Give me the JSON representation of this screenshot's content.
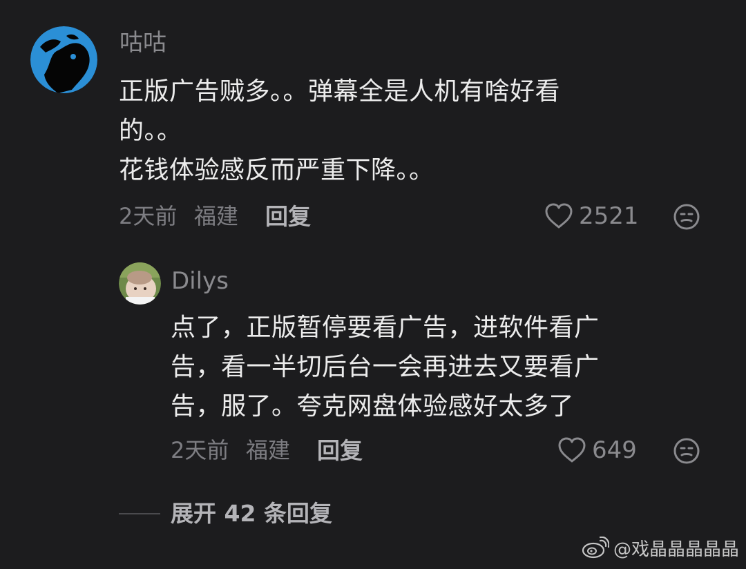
{
  "comments": [
    {
      "username": "咕咕",
      "text": "正版广告贼多。。弹幕全是人机有啥好看\n的。。\n花钱体验感反而严重下降。。",
      "time": "2天前",
      "location": "福建",
      "reply_label": "回复",
      "likes": "2521"
    }
  ],
  "replies": [
    {
      "username": "Dilys",
      "text": "点了，正版暂停要看广告，进软件看广\n告，看一半切后台一会再进去又要看广\n告，服了。夸克网盘体验感好太多了",
      "time": "2天前",
      "location": "福建",
      "reply_label": "回复",
      "likes": "649"
    }
  ],
  "expand_label": "展开 42 条回复",
  "watermark": "@戏晶晶晶晶晶",
  "icons": {
    "like": "heart-outline-icon",
    "emoji": "emoji-face-icon",
    "watermark_logo": "weibo-logo-icon"
  },
  "colors": {
    "background": "#1c1c1e",
    "text_primary": "#ececec",
    "text_secondary": "#8a8a8e",
    "avatar_blue": "#2b8fd6"
  }
}
